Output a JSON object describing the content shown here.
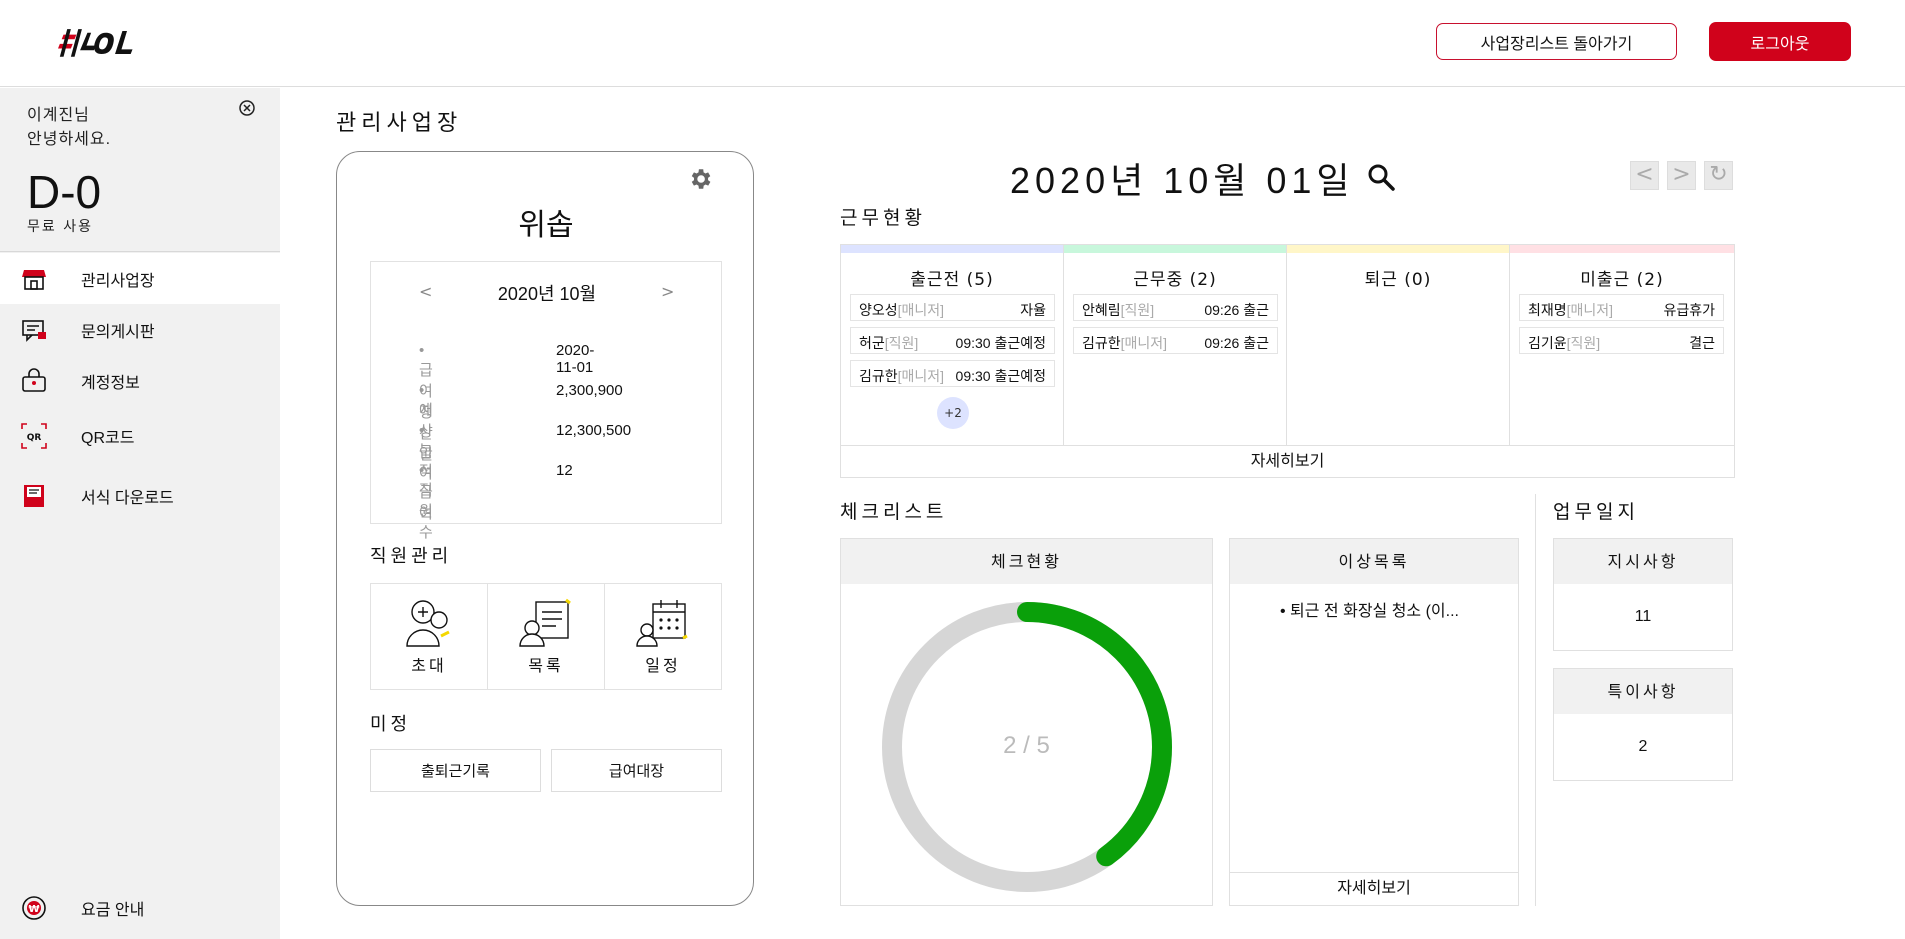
{
  "header": {
    "logo_text": "#YOL",
    "back_button": "사업장리스트 돌아가기",
    "logout_button": "로그아웃"
  },
  "sidebar": {
    "greeting_line1": "이계진님",
    "greeting_line2": "안녕하세요.",
    "dday": "D-0",
    "plan": "무료 사용",
    "items": [
      {
        "label": "관리사업장",
        "icon": "store-icon"
      },
      {
        "label": "문의게시판",
        "icon": "chat-board-icon"
      },
      {
        "label": "계정정보",
        "icon": "lock-bag-icon"
      },
      {
        "label": "QR코드",
        "icon": "qr-code-icon"
      },
      {
        "label": "서식 다운로드",
        "icon": "document-download-icon"
      }
    ],
    "pricing": {
      "label": "요금 안내",
      "icon": "won-icon"
    }
  },
  "page": {
    "title": "관리사업장"
  },
  "business": {
    "name": "위솝",
    "month_prev": "<",
    "month_label": "2020년 10월",
    "month_next": ">",
    "pay_info": [
      {
        "key": "• 급여정산일",
        "value": "2020-11-01"
      },
      {
        "key": "• 예상급여",
        "value": "2,300,900"
      },
      {
        "key": "• 누적급여",
        "value": "12,300,500"
      },
      {
        "key": "• 직원수",
        "value": "12"
      }
    ],
    "employee_section": "직원관리",
    "employee_tiles": [
      "초대",
      "목록",
      "일정"
    ],
    "misc_section": "미정",
    "misc_buttons": [
      "출퇴근기록",
      "급여대장"
    ]
  },
  "date": {
    "title": "2020년 10월 01일",
    "prev": "<",
    "next": ">",
    "refresh": "↻"
  },
  "work_status": {
    "title": "근무현황",
    "columns": [
      {
        "title": "출근전 (5)",
        "color": "#dde3ff",
        "people": [
          {
            "name": "양오성",
            "role": "[매니저]",
            "status": "자율"
          },
          {
            "name": "허군",
            "role": "[직원]",
            "status": "09:30 출근예정"
          },
          {
            "name": "김규한",
            "role": "[매니저]",
            "status": "09:30 출근예정"
          }
        ],
        "more": "+2"
      },
      {
        "title": "근무중 (2)",
        "color": "#c8f7dc",
        "people": [
          {
            "name": "안혜림",
            "role": "[직원]",
            "status": "09:26 출근"
          },
          {
            "name": "김규한",
            "role": "[매니저]",
            "status": "09:26 출근"
          }
        ]
      },
      {
        "title": "퇴근 (0)",
        "color": "#fff6c8",
        "people": []
      },
      {
        "title": "미출근 (2)",
        "color": "#ffe0e4",
        "people": [
          {
            "name": "최재명",
            "role": "[매니저]",
            "status": "유급휴가"
          },
          {
            "name": "김기윤",
            "role": "[직원]",
            "status": "결근"
          }
        ]
      }
    ],
    "detail_link": "자세히보기"
  },
  "checklist": {
    "title": "체크리스트",
    "status_panel": "체크현황",
    "done": 2,
    "total": 5,
    "progress_label": "2 / 5",
    "progress_color": "#0aa00a",
    "abnormal_panel": "이상목록",
    "abnormal_items": [
      "• 퇴근 전 화장실 청소 (이..."
    ],
    "abnormal_detail": "자세히보기"
  },
  "work_log": {
    "title": "업무일지",
    "instructions": {
      "label": "지시사항",
      "count": "11"
    },
    "notes": {
      "label": "특이사항",
      "count": "2"
    }
  }
}
